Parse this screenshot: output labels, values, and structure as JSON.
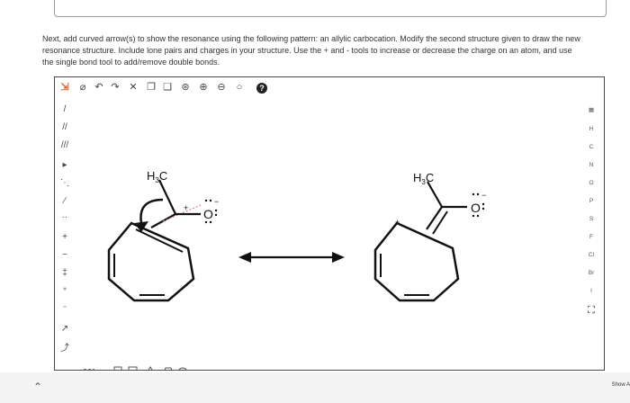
{
  "prompt_text": "Next, add curved arrow(s) to show the resonance using the following pattern: an allylic carbocation. Modify the second structure given to draw the new resonance structure. Include lone pairs and charges in your structure. Use the + and - tools to increase or decrease the charge on an atom, and use the single bond tool to add/remove double bonds.",
  "toolbar": {
    "tools": [
      "select-icon",
      "lasso-icon",
      "undo-icon",
      "redo-icon",
      "delete-icon",
      "copy-icon",
      "paste-icon",
      "zoom-fit-icon",
      "zoom-in-icon",
      "zoom-out-icon",
      "search-icon",
      "help-icon"
    ],
    "left_tools": [
      "single-bond-icon",
      "double-bond-icon",
      "triple-bond-icon",
      "wedge-bond-icon",
      "hash-bond-icon",
      "dash-bond-icon",
      "plus-charge-icon",
      "minus-charge-icon",
      "lone-pair-icon",
      "radical-icon",
      "add-lone-pair-icon",
      "remove-lone-pair-icon",
      "curved-arrow-icon",
      "curved-half-arrow-icon"
    ]
  },
  "periodic": {
    "top_icon": "periodic-table-icon",
    "elements": [
      "H",
      "C",
      "N",
      "O",
      "P",
      "S",
      "F",
      "Cl",
      "Br",
      "I"
    ],
    "bottom_icon": "ring-template-icon"
  },
  "structure1": {
    "methyl": "H3C",
    "methyl_parts": [
      "H",
      "3",
      "C"
    ],
    "charge": "+",
    "oxygen": "O",
    "oxygen_charge": "−"
  },
  "structure2": {
    "methyl": "H3C",
    "methyl_parts": [
      "H",
      "3",
      "C"
    ],
    "charge": "+",
    "oxygen": "O",
    "oxygen_charge": "−"
  },
  "footer": {
    "show_label": "Show A"
  }
}
